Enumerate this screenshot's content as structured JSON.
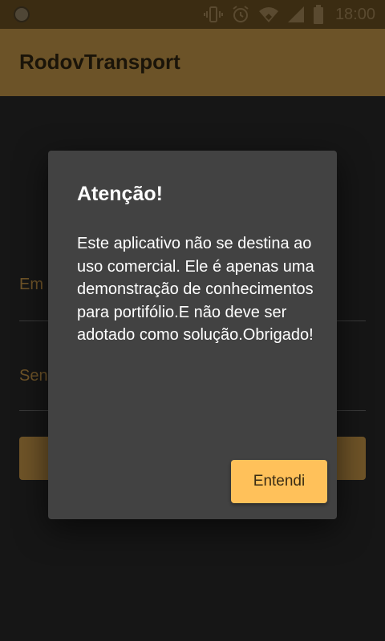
{
  "status_bar": {
    "time": "18:00",
    "icons": [
      "notification-dot-icon",
      "vibrate-icon",
      "alarm-icon",
      "wifi-icon",
      "signal-icon",
      "battery-icon"
    ]
  },
  "app_bar": {
    "title": "RodovTransport",
    "color": "#6c5328"
  },
  "form": {
    "email_label": "Em",
    "senha_label": "Sen",
    "button_color": "#6f5428"
  },
  "dialog": {
    "title": "Atenção!",
    "message": "Este aplicativo não se destina ao uso comercial. Ele é apenas uma demonstração de conhecimentos para portifólio.E não deve ser adotado como solução.Obrigado!",
    "confirm_label": "Entendi",
    "accent_color": "#ffc15a"
  }
}
